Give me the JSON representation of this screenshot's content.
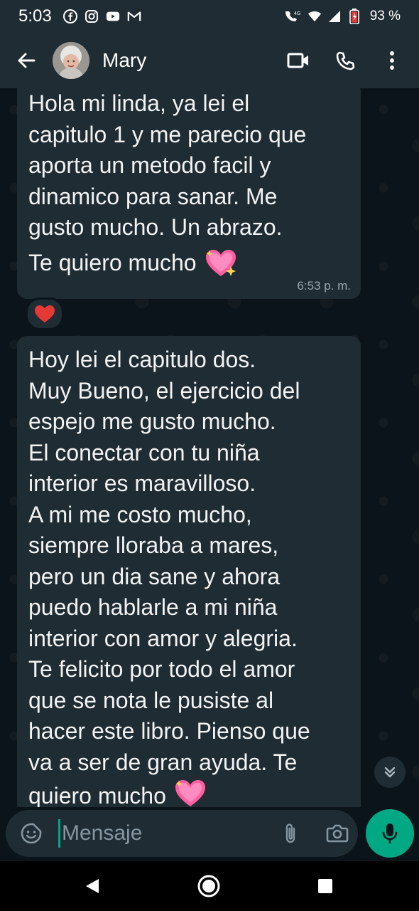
{
  "status_bar": {
    "time": "5:03",
    "battery": "93 %",
    "network": "4G",
    "left_icons": [
      "facebook-icon",
      "instagram-icon",
      "youtube-icon",
      "gmail-icon"
    ],
    "right_icons": [
      "wifi-call-icon",
      "wifi-icon",
      "signal-icon",
      "battery-icon"
    ]
  },
  "app_bar": {
    "contact_name": "Mary",
    "icons": [
      "back-arrow-icon",
      "video-call-icon",
      "phone-icon",
      "more-options-icon"
    ]
  },
  "messages": [
    {
      "lines": [
        "Hola mi linda, ya lei el",
        "capitulo 1 y me parecio que",
        "aporta un metodo facil y",
        "dinamico para sanar. Me",
        "gusto mucho. Un abrazo."
      ],
      "last_line": "Te quiero mucho",
      "emoji": "sparkling-heart",
      "time": "6:53 p. m.",
      "reaction": "red-heart"
    },
    {
      "text": "Hoy lei el capitulo dos.\nMuy Bueno, el ejercicio del\nespejo me gusto mucho.\nEl conectar con tu niña\ninterior es maravilloso.\nA mi me costo mucho,\nsiempre lloraba a mares,\npero un dia sane y ahora\npuedo hablarle a mi niña\ninterior con amor y alegria.\nTe felicito por todo el amor\nque se nota le pusiste al\nhacer este libro. Pienso que\nva a ser de gran ayuda. Te\nquiero mucho",
      "emoji": "sparkling-heart"
    }
  ],
  "input": {
    "placeholder": "Mensaje",
    "value": ""
  },
  "colors": {
    "header": "#1f2c34",
    "chat_background": "#0b141a",
    "bubble": "#202c33",
    "accent": "#00a884"
  }
}
